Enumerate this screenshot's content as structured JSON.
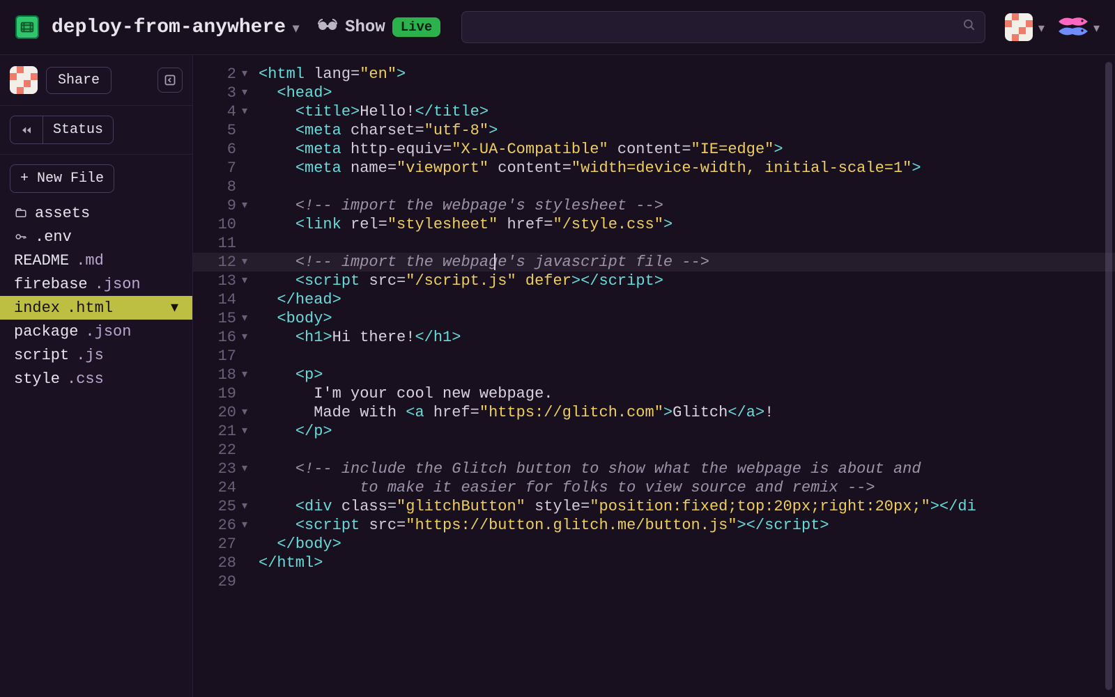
{
  "header": {
    "project_name": "deploy-from-anywhere",
    "show_label": "Show",
    "live_label": "Live",
    "search_placeholder": ""
  },
  "sidebar": {
    "share_label": "Share",
    "rewind_tooltip": "Rewind",
    "status_label": "Status",
    "new_file_label": "+ New File",
    "files": [
      {
        "icon": "folder",
        "name": "assets",
        "ext": ""
      },
      {
        "icon": "key",
        "name": ".env",
        "ext": ""
      },
      {
        "icon": "",
        "name": "README",
        "ext": ".md",
        "ext_class": "ext-md"
      },
      {
        "icon": "",
        "name": "firebase",
        "ext": ".json",
        "ext_class": "ext-json"
      },
      {
        "icon": "",
        "name": "index",
        "ext": ".html",
        "ext_class": "ext-html",
        "selected": true
      },
      {
        "icon": "",
        "name": "package",
        "ext": ".json",
        "ext_class": "ext-json"
      },
      {
        "icon": "",
        "name": "script",
        "ext": ".js",
        "ext_class": "ext-js"
      },
      {
        "icon": "",
        "name": "style",
        "ext": ".css",
        "ext_class": "ext-css"
      }
    ]
  },
  "editor": {
    "highlighted_line": 12,
    "cursor_col_ch": 22,
    "lines": [
      {
        "n": 2,
        "fold": "▾",
        "indent": 0,
        "tokens": [
          [
            "ab",
            "<"
          ],
          [
            "t",
            "html"
          ],
          [
            "x",
            " "
          ],
          [
            "a",
            "lang"
          ],
          [
            "e",
            "="
          ],
          [
            "s",
            "\"en\""
          ],
          [
            "ab",
            ">"
          ]
        ]
      },
      {
        "n": 3,
        "fold": "▾",
        "indent": 1,
        "tokens": [
          [
            "ab",
            "<"
          ],
          [
            "t",
            "head"
          ],
          [
            "ab",
            ">"
          ]
        ]
      },
      {
        "n": 4,
        "fold": "▾",
        "indent": 2,
        "tokens": [
          [
            "ab",
            "<"
          ],
          [
            "t",
            "title"
          ],
          [
            "ab",
            ">"
          ],
          [
            "x",
            "Hello!"
          ],
          [
            "ab",
            "</"
          ],
          [
            "t",
            "title"
          ],
          [
            "ab",
            ">"
          ]
        ]
      },
      {
        "n": 5,
        "fold": "",
        "indent": 2,
        "tokens": [
          [
            "ab",
            "<"
          ],
          [
            "t",
            "meta"
          ],
          [
            "x",
            " "
          ],
          [
            "a",
            "charset"
          ],
          [
            "e",
            "="
          ],
          [
            "s",
            "\"utf-8\""
          ],
          [
            "ab",
            ">"
          ]
        ]
      },
      {
        "n": 6,
        "fold": "",
        "indent": 2,
        "tokens": [
          [
            "ab",
            "<"
          ],
          [
            "t",
            "meta"
          ],
          [
            "x",
            " "
          ],
          [
            "a",
            "http-equiv"
          ],
          [
            "e",
            "="
          ],
          [
            "s",
            "\"X-UA-Compatible\""
          ],
          [
            "x",
            " "
          ],
          [
            "a",
            "content"
          ],
          [
            "e",
            "="
          ],
          [
            "s",
            "\"IE=edge\""
          ],
          [
            "ab",
            ">"
          ]
        ]
      },
      {
        "n": 7,
        "fold": "",
        "indent": 2,
        "tokens": [
          [
            "ab",
            "<"
          ],
          [
            "t",
            "meta"
          ],
          [
            "x",
            " "
          ],
          [
            "a",
            "name"
          ],
          [
            "e",
            "="
          ],
          [
            "s",
            "\"viewport\""
          ],
          [
            "x",
            " "
          ],
          [
            "a",
            "content"
          ],
          [
            "e",
            "="
          ],
          [
            "s",
            "\"width=device-width, initial-scale=1\""
          ],
          [
            "ab",
            ">"
          ]
        ]
      },
      {
        "n": 8,
        "fold": "",
        "indent": 2,
        "tokens": []
      },
      {
        "n": 9,
        "fold": "▾",
        "indent": 2,
        "tokens": [
          [
            "c",
            "<!-- import the webpage's stylesheet -->"
          ]
        ]
      },
      {
        "n": 10,
        "fold": "",
        "indent": 2,
        "tokens": [
          [
            "ab",
            "<"
          ],
          [
            "t",
            "link"
          ],
          [
            "x",
            " "
          ],
          [
            "a",
            "rel"
          ],
          [
            "e",
            "="
          ],
          [
            "s",
            "\"stylesheet\""
          ],
          [
            "x",
            " "
          ],
          [
            "a",
            "href"
          ],
          [
            "e",
            "="
          ],
          [
            "s",
            "\"/style.css\""
          ],
          [
            "ab",
            ">"
          ]
        ]
      },
      {
        "n": 11,
        "fold": "",
        "indent": 2,
        "tokens": []
      },
      {
        "n": 12,
        "fold": "▾",
        "indent": 2,
        "tokens": [
          [
            "c",
            "<!-- import the webpage's javascript file -->"
          ]
        ]
      },
      {
        "n": 13,
        "fold": "▾",
        "indent": 2,
        "tokens": [
          [
            "ab",
            "<"
          ],
          [
            "t",
            "script"
          ],
          [
            "x",
            " "
          ],
          [
            "a",
            "src"
          ],
          [
            "e",
            "="
          ],
          [
            "s",
            "\"/script.js\""
          ],
          [
            "x",
            " "
          ],
          [
            "kw",
            "defer"
          ],
          [
            "ab",
            ">"
          ],
          [
            "ab",
            "</"
          ],
          [
            "t",
            "script"
          ],
          [
            "ab",
            ">"
          ]
        ]
      },
      {
        "n": 14,
        "fold": "",
        "indent": 1,
        "tokens": [
          [
            "ab",
            "</"
          ],
          [
            "t",
            "head"
          ],
          [
            "ab",
            ">"
          ]
        ]
      },
      {
        "n": 15,
        "fold": "▾",
        "indent": 1,
        "tokens": [
          [
            "ab",
            "<"
          ],
          [
            "t",
            "body"
          ],
          [
            "ab",
            ">"
          ]
        ]
      },
      {
        "n": 16,
        "fold": "▾",
        "indent": 2,
        "tokens": [
          [
            "ab",
            "<"
          ],
          [
            "t",
            "h1"
          ],
          [
            "ab",
            ">"
          ],
          [
            "x",
            "Hi there!"
          ],
          [
            "ab",
            "</"
          ],
          [
            "t",
            "h1"
          ],
          [
            "ab",
            ">"
          ]
        ]
      },
      {
        "n": 17,
        "fold": "",
        "indent": 2,
        "tokens": []
      },
      {
        "n": 18,
        "fold": "▾",
        "indent": 2,
        "tokens": [
          [
            "ab",
            "<"
          ],
          [
            "t",
            "p"
          ],
          [
            "ab",
            ">"
          ]
        ]
      },
      {
        "n": 19,
        "fold": "",
        "indent": 3,
        "tokens": [
          [
            "x",
            "I'm your cool new webpage."
          ]
        ]
      },
      {
        "n": 20,
        "fold": "▾",
        "indent": 3,
        "tokens": [
          [
            "x",
            "Made with "
          ],
          [
            "ab",
            "<"
          ],
          [
            "t",
            "a"
          ],
          [
            "x",
            " "
          ],
          [
            "a",
            "href"
          ],
          [
            "e",
            "="
          ],
          [
            "s",
            "\"https://glitch.com\""
          ],
          [
            "ab",
            ">"
          ],
          [
            "x",
            "Glitch"
          ],
          [
            "ab",
            "</"
          ],
          [
            "t",
            "a"
          ],
          [
            "ab",
            ">"
          ],
          [
            "x",
            "!"
          ]
        ]
      },
      {
        "n": 21,
        "fold": "▾",
        "indent": 2,
        "tokens": [
          [
            "ab",
            "</"
          ],
          [
            "t",
            "p"
          ],
          [
            "ab",
            ">"
          ]
        ]
      },
      {
        "n": 22,
        "fold": "",
        "indent": 2,
        "tokens": []
      },
      {
        "n": 23,
        "fold": "▾",
        "indent": 2,
        "tokens": [
          [
            "c",
            "<!-- include the Glitch button to show what the webpage is about and"
          ]
        ]
      },
      {
        "n": 24,
        "fold": "",
        "indent": 2,
        "tokens": [
          [
            "c",
            "       to make it easier for folks to view source and remix -->"
          ]
        ]
      },
      {
        "n": 25,
        "fold": "▾",
        "indent": 2,
        "tokens": [
          [
            "ab",
            "<"
          ],
          [
            "t",
            "div"
          ],
          [
            "x",
            " "
          ],
          [
            "a",
            "class"
          ],
          [
            "e",
            "="
          ],
          [
            "s",
            "\"glitchButton\""
          ],
          [
            "x",
            " "
          ],
          [
            "a",
            "style"
          ],
          [
            "e",
            "="
          ],
          [
            "s",
            "\"position:fixed;top:20px;right:20px;\""
          ],
          [
            "ab",
            ">"
          ],
          [
            "ab",
            "</"
          ],
          [
            "t",
            "di"
          ]
        ]
      },
      {
        "n": 26,
        "fold": "▾",
        "indent": 2,
        "tokens": [
          [
            "ab",
            "<"
          ],
          [
            "t",
            "script"
          ],
          [
            "x",
            " "
          ],
          [
            "a",
            "src"
          ],
          [
            "e",
            "="
          ],
          [
            "s",
            "\"https://button.glitch.me/button.js\""
          ],
          [
            "ab",
            ">"
          ],
          [
            "ab",
            "</"
          ],
          [
            "t",
            "script"
          ],
          [
            "ab",
            ">"
          ]
        ]
      },
      {
        "n": 27,
        "fold": "",
        "indent": 1,
        "tokens": [
          [
            "ab",
            "</"
          ],
          [
            "t",
            "body"
          ],
          [
            "ab",
            ">"
          ]
        ]
      },
      {
        "n": 28,
        "fold": "",
        "indent": 0,
        "tokens": [
          [
            "ab",
            "</"
          ],
          [
            "t",
            "html"
          ],
          [
            "ab",
            ">"
          ]
        ]
      },
      {
        "n": 29,
        "fold": "",
        "indent": 0,
        "tokens": []
      }
    ]
  }
}
